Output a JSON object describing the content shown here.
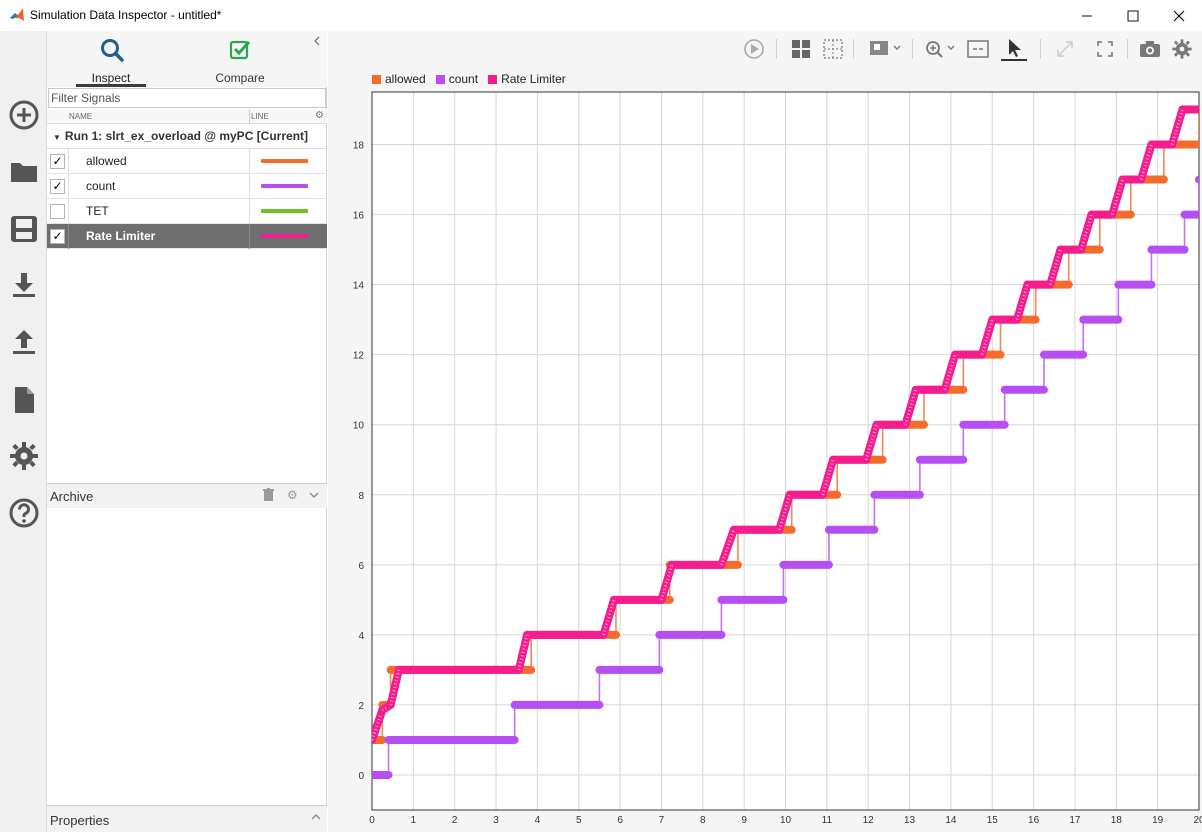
{
  "window": {
    "title": "Simulation Data Inspector - untitled*",
    "minimize": "—",
    "maximize": "☐",
    "close": "✕"
  },
  "left_toolstrip": [
    "add-icon",
    "folder-icon",
    "save-icon",
    "download-icon",
    "upload-icon",
    "document-icon",
    "gear-icon",
    "help-icon"
  ],
  "tabs": [
    {
      "label": "Inspect",
      "icon": "search-icon",
      "active": true
    },
    {
      "label": "Compare",
      "icon": "check-icon",
      "active": false
    }
  ],
  "filter": {
    "placeholder": "Filter Signals"
  },
  "columns": {
    "name": "NAME",
    "line": "LINE"
  },
  "run": {
    "label": "Run 1: slrt_ex_overload @ myPC [Current]"
  },
  "signals": [
    {
      "name": "allowed",
      "checked": true,
      "color": "#f36c2b",
      "selected": false
    },
    {
      "name": "count",
      "checked": true,
      "color": "#b64ef2",
      "selected": false
    },
    {
      "name": "TET",
      "checked": false,
      "color": "#6cc421",
      "selected": false
    },
    {
      "name": "Rate Limiter",
      "checked": true,
      "color": "#f61c8e",
      "selected": true
    }
  ],
  "archive": {
    "label": "Archive"
  },
  "properties": {
    "label": "Properties"
  },
  "chart_data": {
    "type": "line",
    "title": "",
    "xlabel": "",
    "ylabel": "",
    "xlim": [
      0,
      20
    ],
    "ylim": [
      -1,
      19.5
    ],
    "xticks": [
      0,
      1,
      2,
      3,
      4,
      5,
      6,
      7,
      8,
      9,
      10,
      11,
      12,
      13,
      14,
      15,
      16,
      17,
      18,
      19,
      20
    ],
    "yticks": [
      0,
      2,
      4,
      6,
      8,
      10,
      12,
      14,
      16,
      18
    ],
    "grid": true,
    "legend_position": "top-left",
    "series": [
      {
        "name": "allowed",
        "color": "#f36c2b",
        "step": true,
        "x": [
          0,
          0.25,
          0.45,
          0.75,
          3.85,
          5.9,
          7.2,
          8.85,
          10.15,
          11.25,
          12.35,
          13.35,
          14.3,
          15.2,
          16.05,
          16.85,
          17.6,
          18.35,
          19.15,
          20
        ],
        "y": [
          1,
          2,
          3,
          3,
          4,
          5,
          6,
          7,
          8,
          9,
          10,
          11,
          12,
          13,
          14,
          15,
          16,
          17,
          18,
          19
        ]
      },
      {
        "name": "count",
        "color": "#b64ef2",
        "step": true,
        "x": [
          0,
          0.4,
          3.45,
          5.5,
          6.95,
          8.45,
          9.95,
          11.05,
          12.15,
          13.25,
          14.3,
          15.3,
          16.25,
          17.2,
          18.05,
          18.85,
          19.65,
          20
        ],
        "y": [
          0,
          1,
          2,
          3,
          4,
          5,
          6,
          7,
          8,
          9,
          10,
          11,
          12,
          13,
          14,
          15,
          16,
          17
        ]
      },
      {
        "name": "Rate Limiter",
        "color": "#f61c8e",
        "x": [
          0,
          0.25,
          0.45,
          0.65,
          3.55,
          3.75,
          5.6,
          5.85,
          7.0,
          7.25,
          8.45,
          8.75,
          9.85,
          10.1,
          10.9,
          11.15,
          11.95,
          12.2,
          12.9,
          13.15,
          13.85,
          14.1,
          14.75,
          15.0,
          15.6,
          15.85,
          16.4,
          16.65,
          17.15,
          17.4,
          17.9,
          18.15,
          18.6,
          18.85,
          19.35,
          19.6,
          20
        ],
        "y": [
          1,
          1.85,
          2,
          3,
          3,
          4,
          4,
          5,
          5,
          6,
          6,
          7,
          7,
          8,
          8,
          9,
          9,
          10,
          10,
          11,
          11,
          12,
          12,
          13,
          13,
          14,
          14,
          15,
          15,
          16,
          16,
          17,
          17,
          18,
          18,
          19,
          19
        ]
      }
    ]
  }
}
